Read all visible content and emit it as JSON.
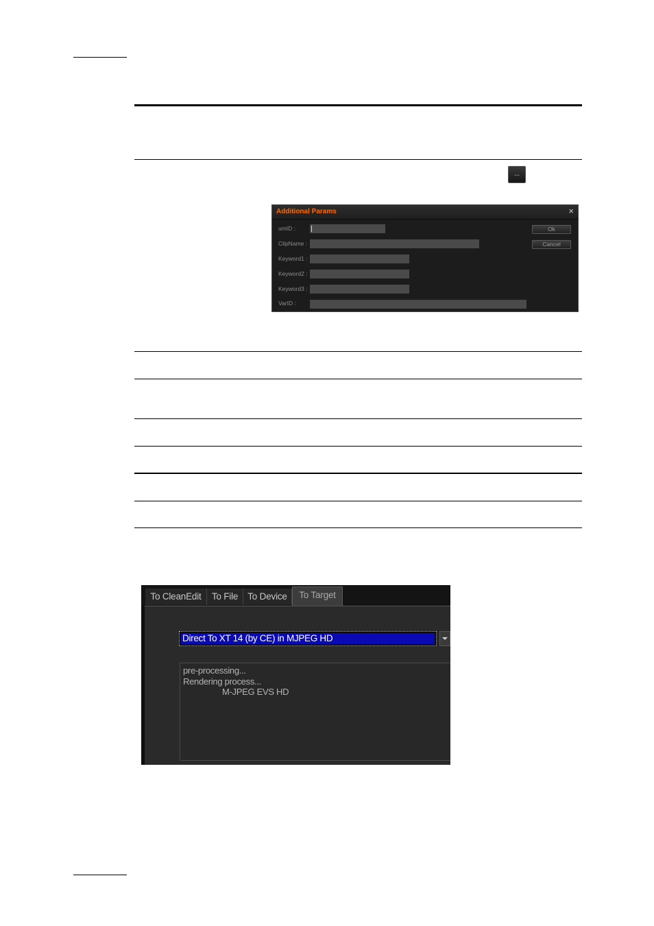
{
  "dialog": {
    "title": "Additional Params",
    "close_glyph": "×",
    "fields": [
      {
        "label": "umID :"
      },
      {
        "label": "ClipName :"
      },
      {
        "label": "Keyword1 :"
      },
      {
        "label": "Keyword2 :"
      },
      {
        "label": "Keyword3 :"
      },
      {
        "label": "VarID :"
      }
    ],
    "ok_label": "Ok",
    "cancel_label": "Cancel"
  },
  "ellipsis_button": {
    "label": "..."
  },
  "transfer_panel": {
    "tabs": [
      {
        "label": "To CleanEdit"
      },
      {
        "label": "To File"
      },
      {
        "label": "To Device"
      },
      {
        "label": "To Target",
        "active": true
      }
    ],
    "target_select": {
      "value": "Direct To XT 14 (by CE) in MJPEG HD"
    },
    "log_lines": [
      "pre-processing...",
      "Rendering process...",
      "M-JPEG EVS HD"
    ]
  },
  "colors": {
    "title_accent": "#ff6a00",
    "select_highlight": "#0a0ab4",
    "panel_bg": "#2a2a2a"
  }
}
